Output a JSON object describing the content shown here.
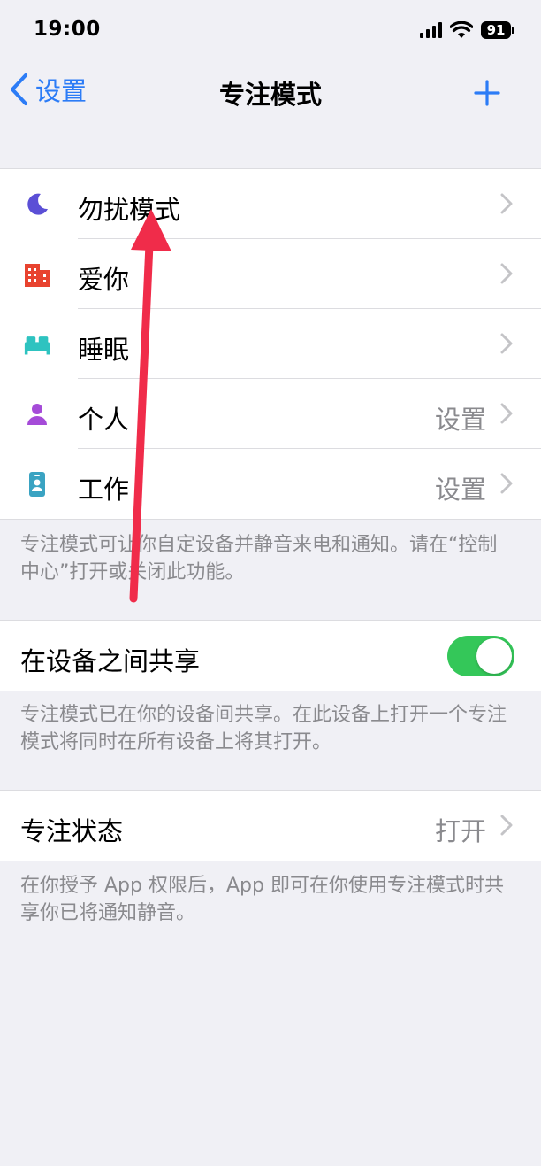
{
  "status_bar": {
    "time": "19:00",
    "battery": "91"
  },
  "nav": {
    "back_label": "设置",
    "title": "专注模式"
  },
  "focus_modes": [
    {
      "label": "勿扰模式",
      "value": "",
      "icon": "moon-icon",
      "color": "#5b4fd6"
    },
    {
      "label": "爱你",
      "value": "",
      "icon": "building-icon",
      "color": "#e8432f"
    },
    {
      "label": "睡眠",
      "value": "",
      "icon": "bed-icon",
      "color": "#2ec3c0"
    },
    {
      "label": "个人",
      "value": "设置",
      "icon": "person-icon",
      "color": "#a54bd8"
    },
    {
      "label": "工作",
      "value": "设置",
      "icon": "id-badge-icon",
      "color": "#3aa3c2"
    }
  ],
  "focus_footer": "专注模式可让你自定设备并静音来电和通知。请在“控制中心”打开或关闭此功能。",
  "share": {
    "label": "在设备之间共享",
    "enabled": true
  },
  "share_footer": "专注模式已在你的设备间共享。在此设备上打开一个专注模式将同时在所有设备上将其打开。",
  "focus_status": {
    "label": "专注状态",
    "value": "打开"
  },
  "status_footer": "在你授予 App 权限后，App 即可在你使用专注模式时共享你已将通知静音。",
  "colors": {
    "accent": "#2c7cf6",
    "toggle_on": "#34c759",
    "annotation_arrow": "#f02c4a"
  }
}
